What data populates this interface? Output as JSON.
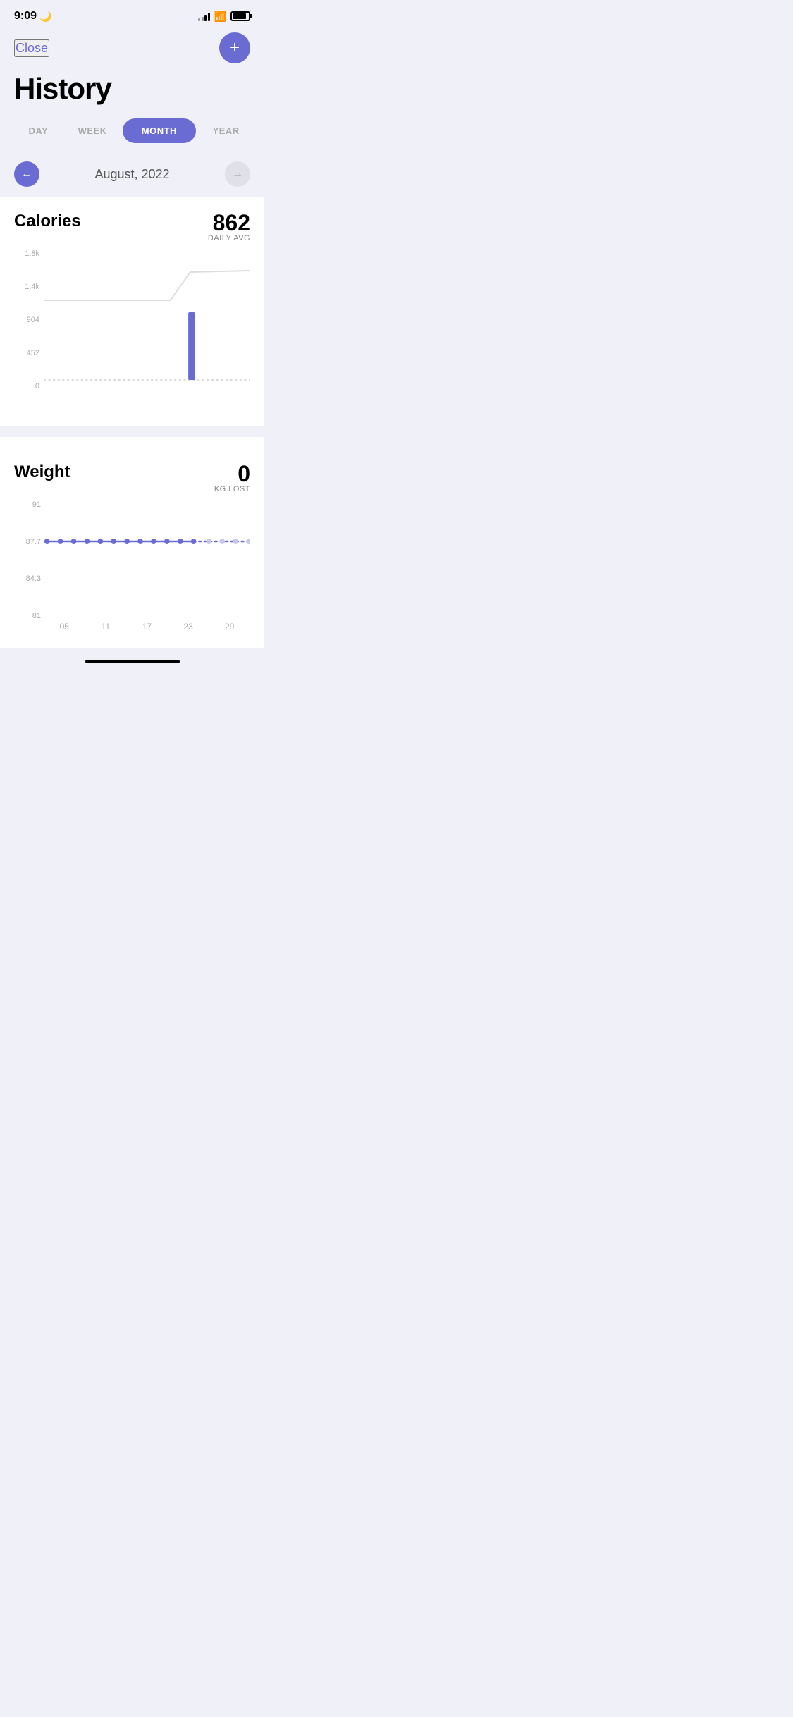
{
  "statusBar": {
    "time": "9:09",
    "moonIcon": "🌙"
  },
  "nav": {
    "closeLabel": "Close",
    "addIcon": "+"
  },
  "page": {
    "title": "History"
  },
  "periodTabs": {
    "tabs": [
      {
        "id": "day",
        "label": "DAY",
        "active": false
      },
      {
        "id": "week",
        "label": "WEEK",
        "active": false
      },
      {
        "id": "month",
        "label": "MONTH",
        "active": true
      },
      {
        "id": "year",
        "label": "YEAR",
        "active": false
      }
    ]
  },
  "dateNav": {
    "prevIcon": "←",
    "nextIcon": "→",
    "currentDate": "August, 2022"
  },
  "caloriesChart": {
    "title": "Calories",
    "dailyAvgValue": "862",
    "dailyAvgLabel": "DAILY AVG",
    "yLabels": [
      "1.8k",
      "1.4k",
      "904",
      "452",
      "0"
    ]
  },
  "weightChart": {
    "title": "Weight",
    "statValue": "0",
    "statLabel": "KG LOST",
    "yLabels": [
      "91",
      "87.7",
      "84.3",
      "81"
    ],
    "xLabels": [
      "05",
      "11",
      "17",
      "23",
      "29"
    ]
  }
}
